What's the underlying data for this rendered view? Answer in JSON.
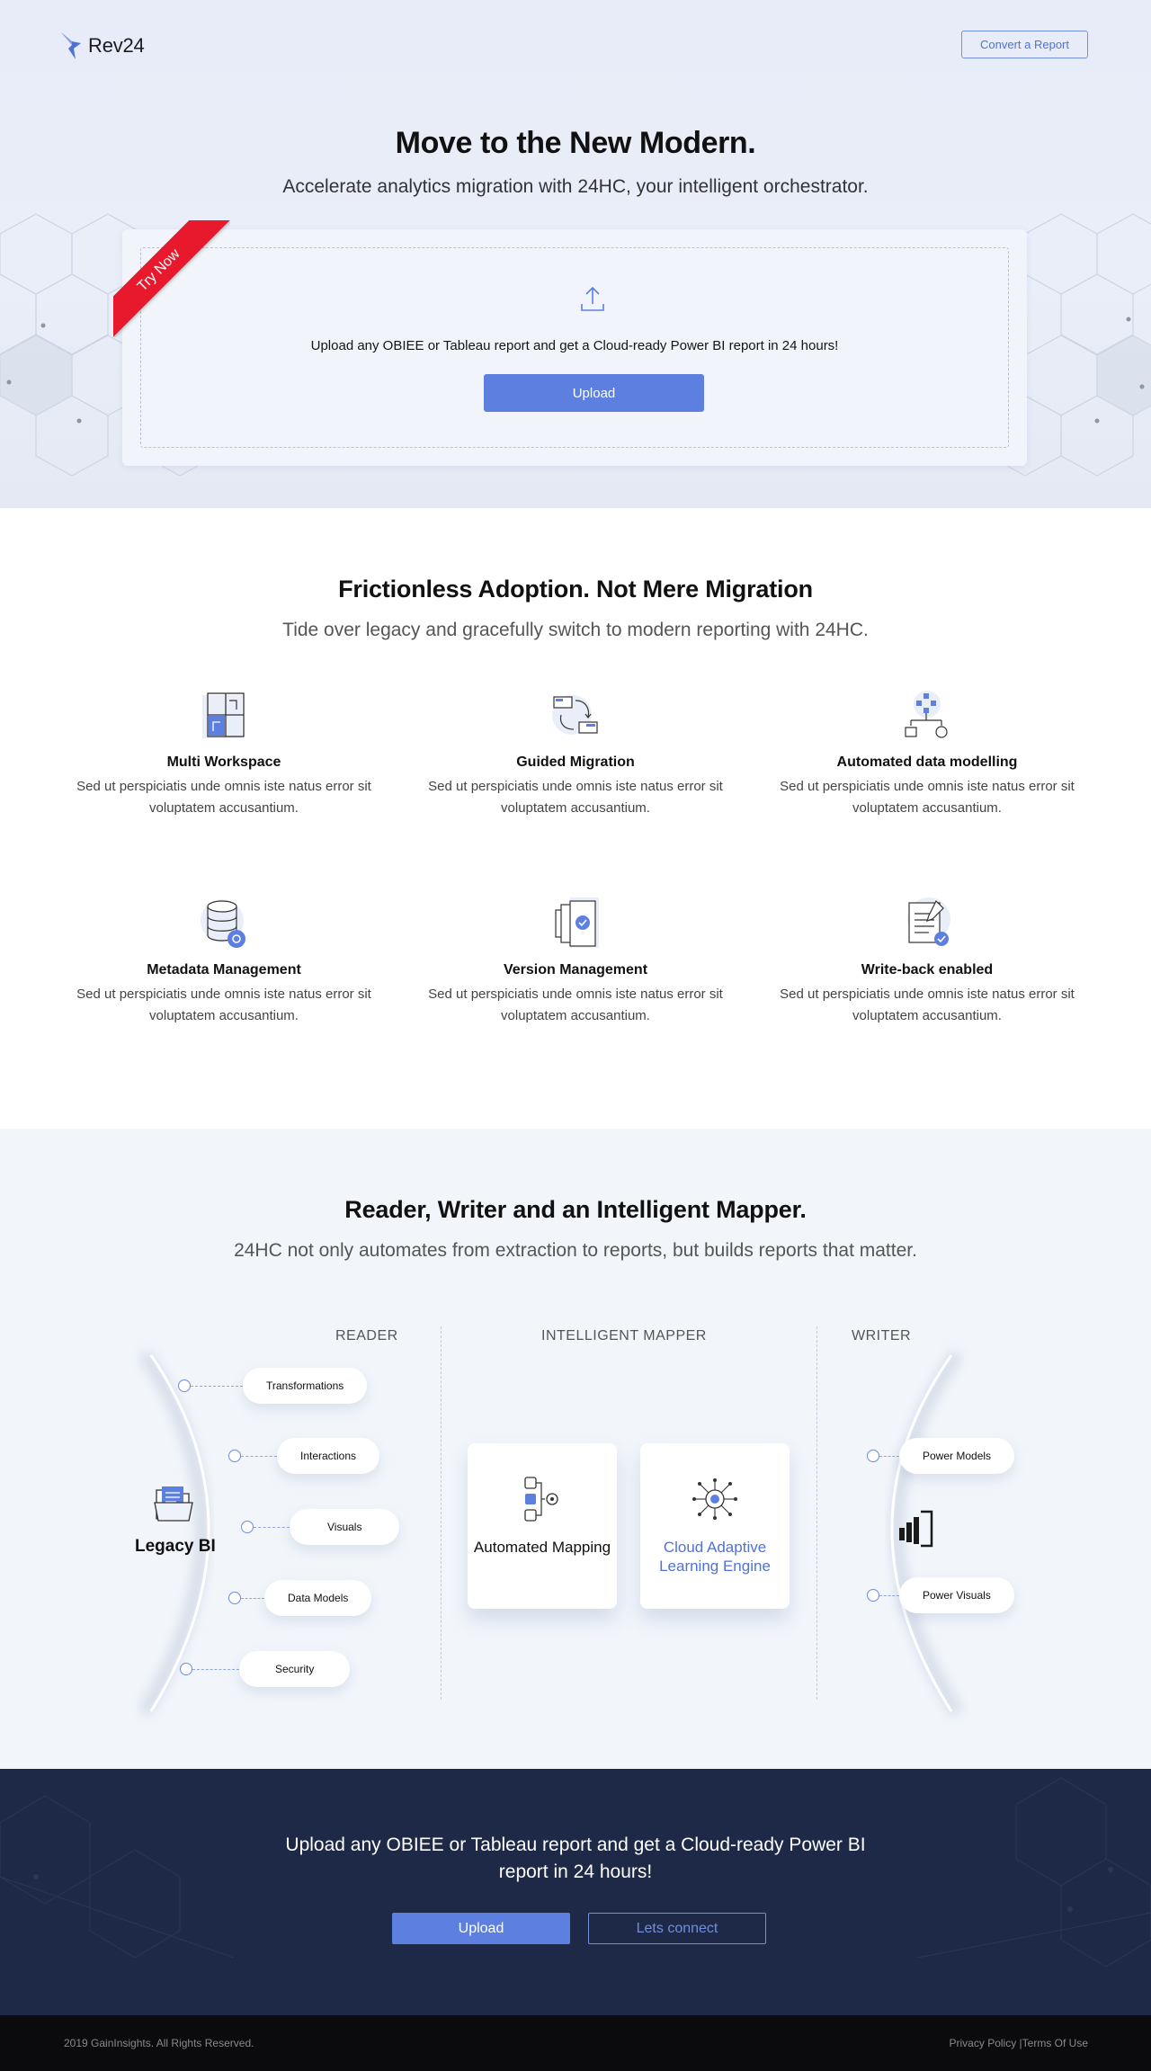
{
  "header": {
    "logo_text": "Rev24",
    "convert_button": "Convert a Report"
  },
  "hero": {
    "title": "Move to the New Modern.",
    "subtitle": "Accelerate analytics migration with 24HC, your intelligent orchestrator.",
    "ribbon": "Try Now",
    "upload_text": "Upload any OBIEE or Tableau report and get a Cloud-ready Power BI report in 24 hours!",
    "upload_button": "Upload"
  },
  "features": {
    "title": "Frictionless Adoption. Not Mere Migration",
    "subtitle": "Tide over legacy and gracefully switch to modern reporting with 24HC.",
    "items": [
      {
        "title": "Multi Workspace",
        "desc": "Sed ut perspiciatis unde omnis iste natus error sit voluptatem accusantium.",
        "icon": "workspace-icon"
      },
      {
        "title": "Guided Migration",
        "desc": "Sed ut perspiciatis unde omnis iste natus error sit voluptatem accusantium.",
        "icon": "migration-icon"
      },
      {
        "title": "Automated data modelling",
        "desc": "Sed ut perspiciatis unde omnis iste natus error sit voluptatem accusantium.",
        "icon": "data-model-icon"
      },
      {
        "title": "Metadata Management",
        "desc": "Sed ut perspiciatis unde omnis iste natus error sit voluptatem accusantium.",
        "icon": "database-icon"
      },
      {
        "title": "Version Management",
        "desc": "Sed ut perspiciatis unde omnis iste natus error sit voluptatem accusantium.",
        "icon": "version-icon"
      },
      {
        "title": "Write-back enabled",
        "desc": "Sed ut perspiciatis unde omnis iste natus error sit voluptatem accusantium.",
        "icon": "write-back-icon"
      }
    ]
  },
  "mapper": {
    "title": "Reader, Writer and an Intelligent Mapper.",
    "subtitle": "24HC not only automates from extraction to reports, but builds reports that matter.",
    "reader_heading": "READER",
    "mapper_heading": "INTELLIGENT MAPPER",
    "writer_heading": "WRITER",
    "legacy_label": "Legacy BI",
    "reader_items": [
      "Transformations",
      "Interactions",
      "Visuals",
      "Data Models",
      "Security"
    ],
    "cards": [
      {
        "label": "Automated Mapping"
      },
      {
        "label": "Cloud Adaptive Learning Engine"
      }
    ],
    "writer_items": [
      "Power Models",
      "Power Visuals"
    ]
  },
  "cta": {
    "text": "Upload any OBIEE or Tableau report and get a Cloud-ready Power BI report in 24 hours!",
    "upload_button": "Upload",
    "connect_button": "Lets connect"
  },
  "footer": {
    "copyright": "2019 GainInsights. All Rights Reserved.",
    "privacy": "Privacy Policy",
    "separator": " |",
    "terms": "Terms Of Use"
  },
  "colors": {
    "accent": "#5d80e0",
    "ribbon": "#e8192c",
    "cta_bg": "#1e2847",
    "footer_bg": "#0b0b0d"
  }
}
